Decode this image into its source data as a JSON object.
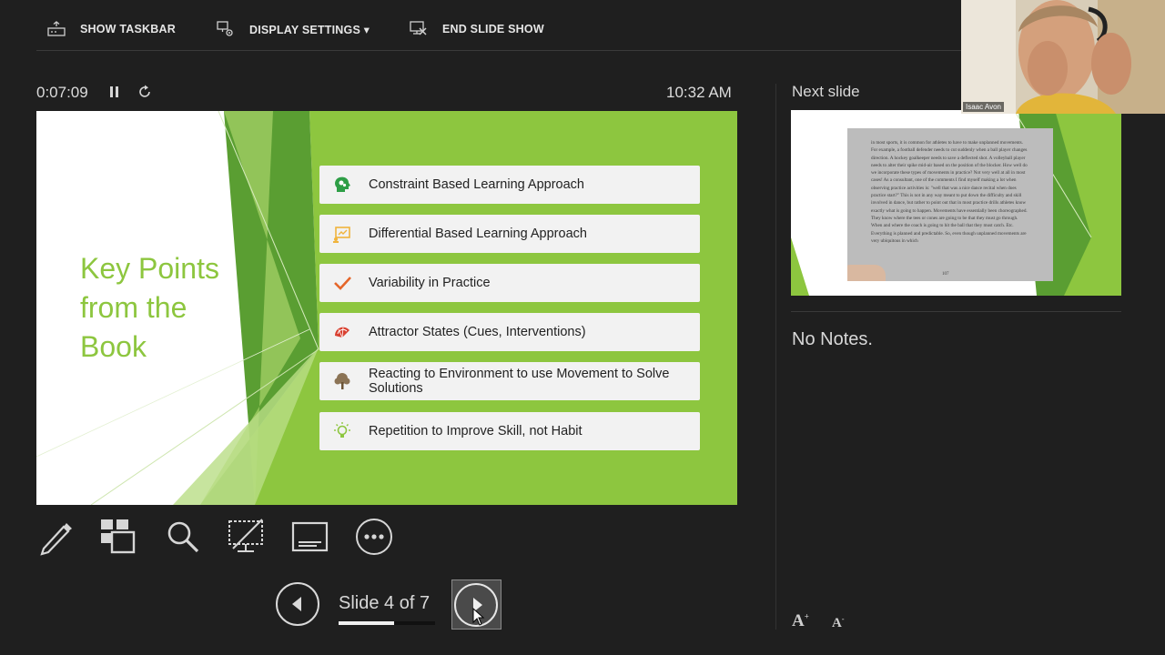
{
  "toolbar": {
    "show_taskbar": "SHOW TASKBAR",
    "display_settings": "DISPLAY SETTINGS ▾",
    "end_slide_show": "END SLIDE SHOW"
  },
  "presenter": {
    "elapsed_time": "0:07:09",
    "clock": "10:32 AM",
    "slide_counter": "Slide 4 of 7",
    "current_slide_number": 4,
    "total_slides": 7
  },
  "slide": {
    "title_lines": [
      "Key Points",
      "from the",
      "Book"
    ],
    "bullets": [
      {
        "text": "Constraint Based Learning Approach",
        "icon": "head-gears-icon"
      },
      {
        "text": "Differential Based Learning Approach",
        "icon": "presentation-chart-icon"
      },
      {
        "text": "Variability in Practice",
        "icon": "checkmark-icon"
      },
      {
        "text": "Attractor States (Cues, Interventions)",
        "icon": "fan-icon"
      },
      {
        "text": "Reacting to Environment to use Movement to Solve Solutions",
        "icon": "tree-icon"
      },
      {
        "text": "Repetition to Improve Skill, not Habit",
        "icon": "lightbulb-icon"
      }
    ]
  },
  "right_panel": {
    "next_slide_label": "Next slide",
    "notes": "No Notes.",
    "book_excerpt": "in most sports, it is common for athletes to have to make unplanned movements. For example, a football defender needs to cut suddenly when a ball player changes direction. A hockey goalkeeper needs to save a deflected shot. A volleyball player needs to alter their spike mid-air based on the position of the blocker. How well do we incorporate these types of movements in practice? Not very well at all in most cases! As a consultant, one of the comments I find myself making a lot when observing practice activities is: \"well that was a nice dance recital when does practice start?\" This is not in any way meant to put down the difficulty and skill involved in dance, but rather to point out that in most practice drills athletes know exactly what is going to happen. Movements have essentially been choreographed. They know where the tees or cones are going to be that they must go through. When and where the coach is going to hit the ball that they must catch. Etc. Everything is planned and predictable. So, even though unplanned movements are very ubiquitous in which",
    "book_page_number": "107"
  },
  "webcam": {
    "name": "Isaac Avon"
  },
  "colors": {
    "accent_green": "#8dc63f",
    "dark_green": "#5a9e32",
    "background": "#1f1f1f"
  }
}
